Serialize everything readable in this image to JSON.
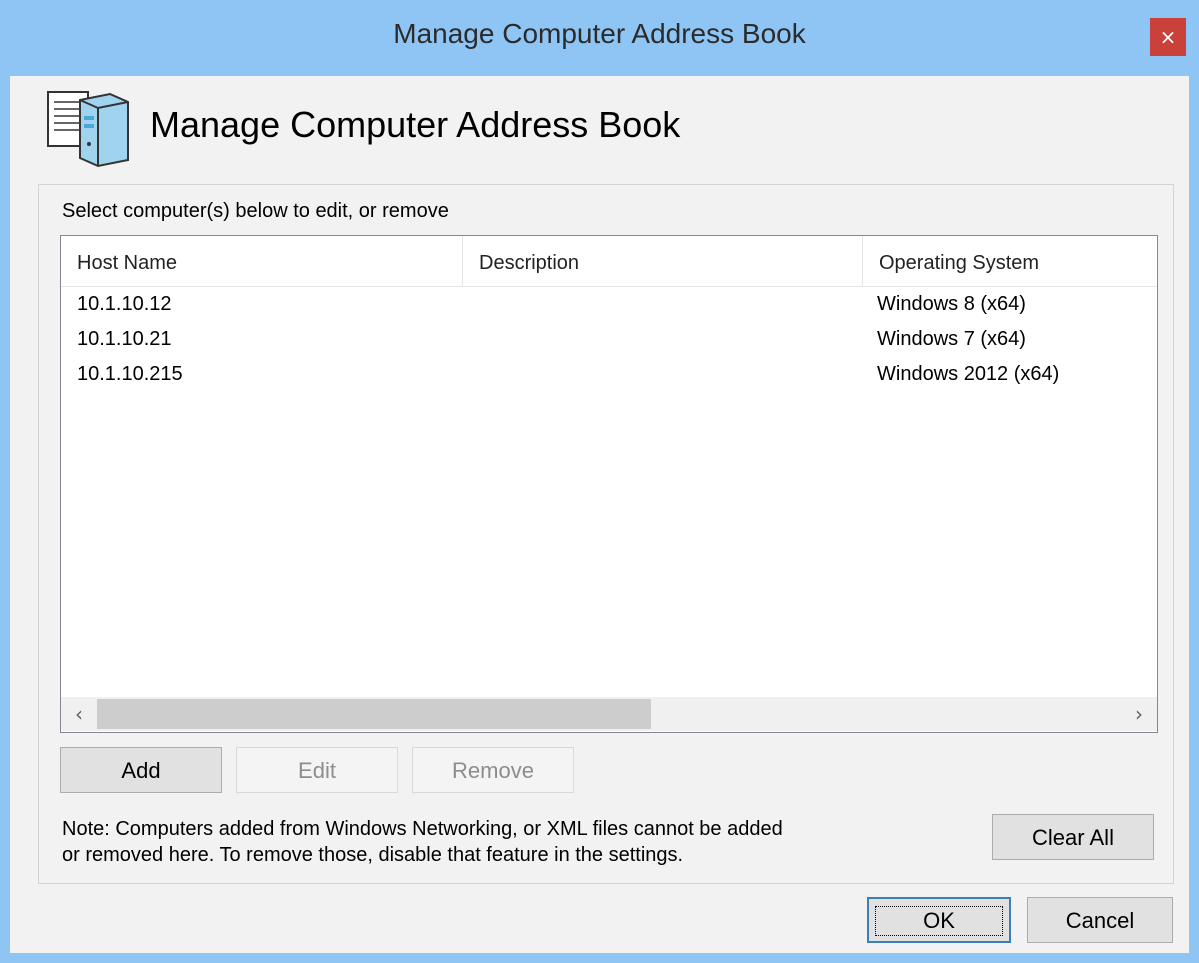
{
  "window": {
    "title": "Manage Computer Address Book",
    "close_glyph": "×",
    "close_color": "#c9413a",
    "frame_color": "#8ec5f5"
  },
  "header": {
    "icon": "address-book-computer-icon",
    "title": "Manage Computer Address Book"
  },
  "group": {
    "label": "Select computer(s) below to edit, or remove"
  },
  "table": {
    "columns": [
      "Host Name",
      "Description",
      "Operating System"
    ],
    "rows": [
      {
        "host": "10.1.10.12",
        "description": "",
        "os": "Windows 8 (x64)"
      },
      {
        "host": "10.1.10.21",
        "description": "",
        "os": "Windows 7 (x64)"
      },
      {
        "host": "10.1.10.215",
        "description": "",
        "os": "Windows 2012 (x64)"
      }
    ],
    "scroll_left_glyph": "‹",
    "scroll_right_glyph": "›"
  },
  "actions": {
    "add": "Add",
    "edit": "Edit",
    "remove": "Remove",
    "clear_all": "Clear All"
  },
  "note": {
    "line1": "Note: Computers added from Windows Networking, or XML files cannot be added",
    "line2": "or removed here. To remove those, disable that feature in the settings."
  },
  "footer": {
    "ok": "OK",
    "cancel": "Cancel"
  }
}
